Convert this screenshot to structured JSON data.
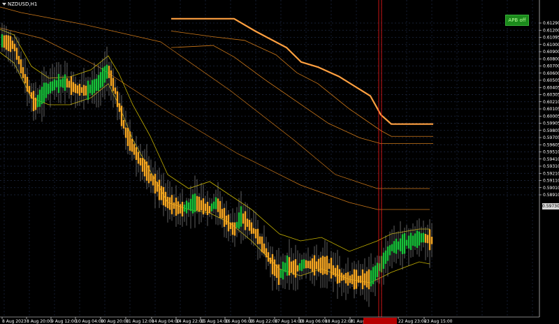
{
  "window": {
    "title": "NZDUSD,H1"
  },
  "indicator_badge": {
    "label": "APB off"
  },
  "price_axis": {
    "labels": [
      "0.61290",
      "0.61200",
      "0.61095",
      "0.61000",
      "0.60900",
      "0.60800",
      "0.60700",
      "0.60600",
      "0.60505",
      "0.60405",
      "0.60305",
      "0.60210",
      "0.60105",
      "0.60005",
      "0.59905",
      "0.59805",
      "0.59705",
      "0.59605",
      "0.59510",
      "0.59410",
      "0.59310",
      "0.59210",
      "0.59110",
      "0.59010",
      "0.58910"
    ],
    "current_price": "0.59730"
  },
  "time_axis": {
    "labels": [
      "8 Aug 2023",
      "8 Aug 20:00",
      "9 Aug 12:00",
      "10 Aug 04:00",
      "10 Aug 20:00",
      "11 Aug 12:00",
      "14 Aug 04:00",
      "14 Aug 22:00",
      "15 Aug 14:00",
      "16 Aug 06:00",
      "16 Aug 22:00",
      "17 Aug 14:00",
      "18 Aug 06:00",
      "18 Aug 22:00",
      "21 Aug 1",
      "22 Aug 23:00",
      "23 Aug 15:00"
    ]
  },
  "colors": {
    "background": "#000000",
    "grid": "#1f2a44",
    "bull": "#18c13a",
    "bear": "#f5a623",
    "wick": "#9e9e9e",
    "envelope": "#c8b400",
    "line_orange": "#ffa040",
    "line_thin": "#d07a1a",
    "vline": "#ff1a1a"
  },
  "chart_data": {
    "type": "candlestick",
    "symbol": "NZDUSD",
    "timeframe": "H1",
    "ylim": [
      0.5885,
      0.6135
    ],
    "overlay_lines": [
      {
        "name": "",
        "points": [
          [
            0,
            0.6135
          ],
          [
            30,
            0.6135
          ],
          [
            40,
            0.6118
          ],
          [
            55,
            0.6095
          ],
          [
            62,
            0.6075
          ],
          [
            70,
            0.6068
          ],
          [
            80,
            0.6055
          ],
          [
            95,
            0.6028
          ],
          [
            100,
            0.6002
          ],
          [
            105,
            0.5989
          ],
          [
            125,
            0.5989
          ]
        ]
      },
      {
        "name": "",
        "points": [
          [
            0,
            0.6118
          ],
          [
            20,
            0.611
          ],
          [
            35,
            0.6105
          ],
          [
            50,
            0.6085
          ],
          [
            60,
            0.606
          ],
          [
            70,
            0.6045
          ],
          [
            85,
            0.601
          ],
          [
            100,
            0.598
          ],
          [
            105,
            0.5972
          ],
          [
            125,
            0.5972
          ]
        ]
      },
      {
        "name": "",
        "points": [
          [
            0,
            0.6095
          ],
          [
            20,
            0.6098
          ],
          [
            30,
            0.6082
          ],
          [
            45,
            0.605
          ],
          [
            60,
            0.602
          ],
          [
            75,
            0.599
          ],
          [
            90,
            0.597
          ],
          [
            100,
            0.5962
          ],
          [
            125,
            0.5962
          ]
        ]
      }
    ]
  }
}
